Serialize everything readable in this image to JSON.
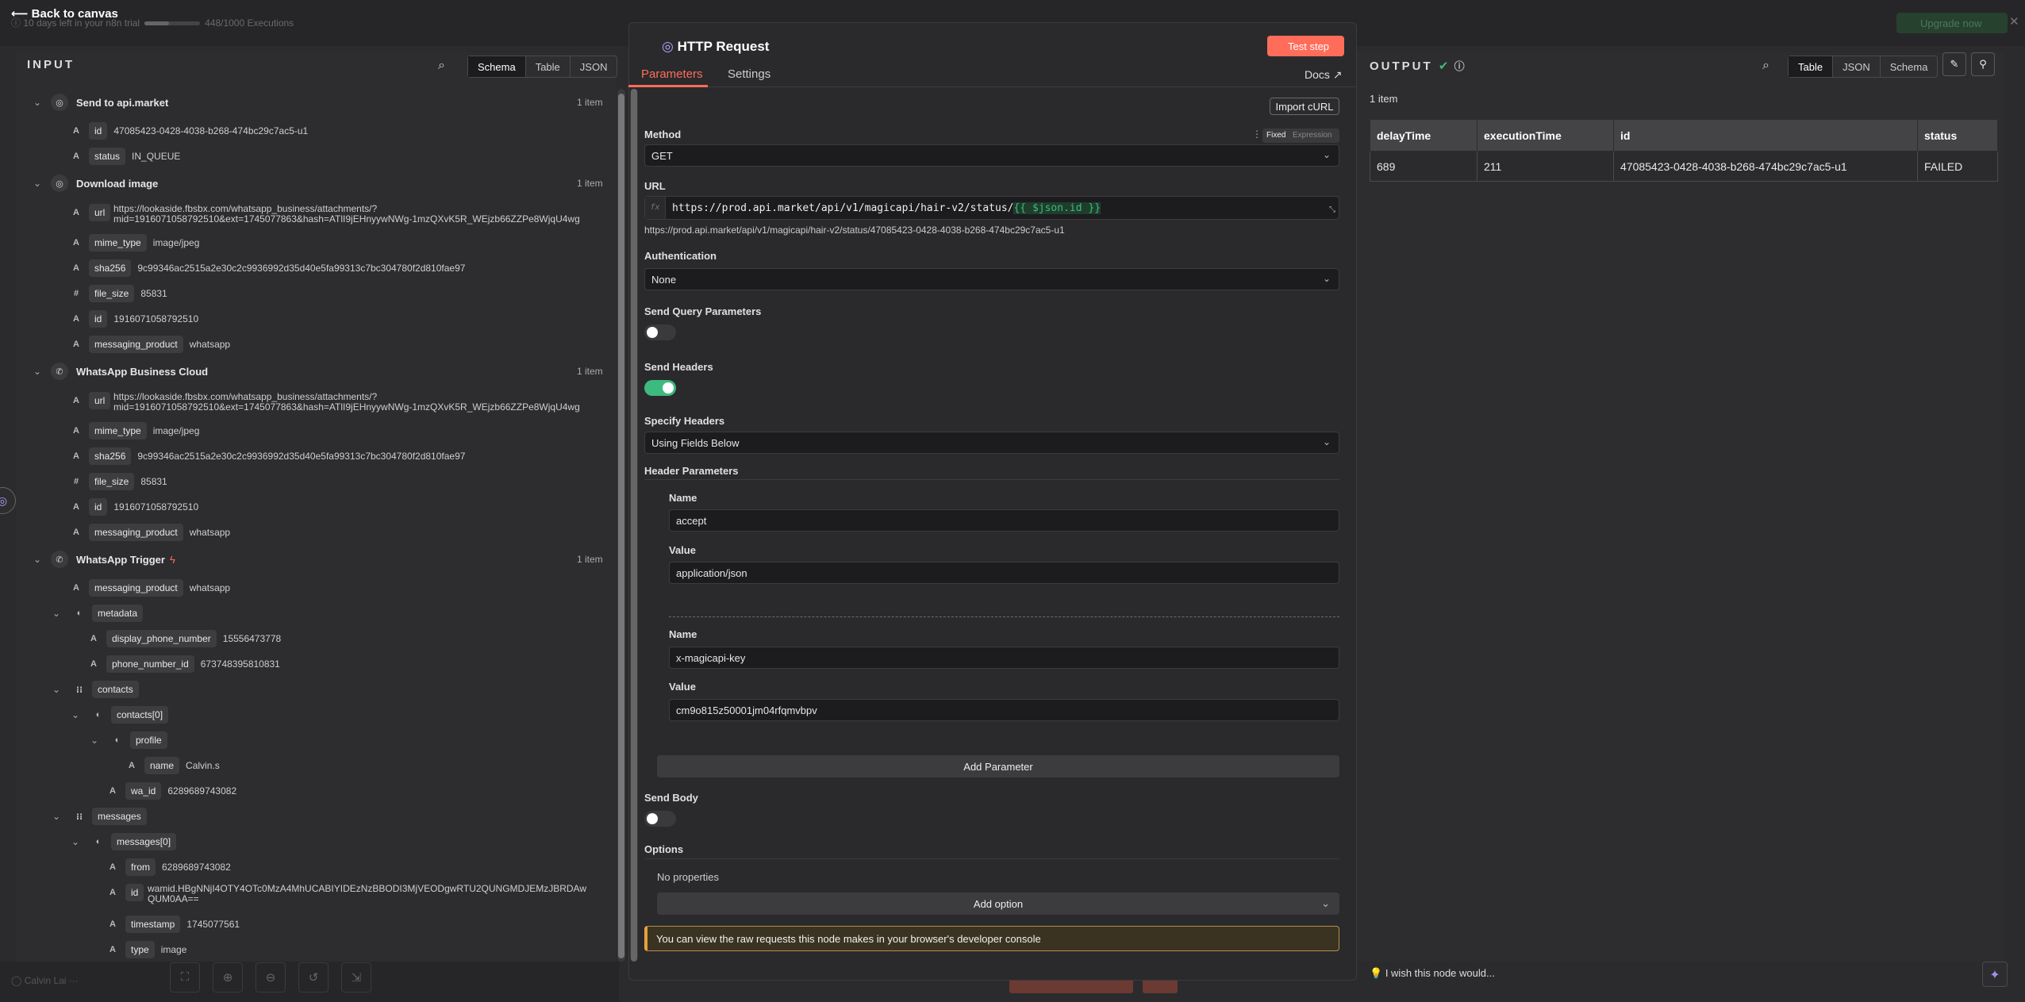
{
  "topbar": {
    "back": "Back to canvas",
    "trial": "10 days left in your n8n trial",
    "executions": "448/1000 Executions",
    "upgrade": "Upgrade now",
    "executions_fill": 0.448
  },
  "input": {
    "title": "INPUT",
    "views": [
      "Schema",
      "Table",
      "JSON"
    ],
    "active_view": "Schema",
    "nodes": [
      {
        "name": "Send to api.market",
        "count": "1 item",
        "fields": [
          [
            "A",
            "id",
            "47085423-0428-4038-b268-474bc29c7ac5-u1"
          ],
          [
            "A",
            "status",
            "IN_QUEUE"
          ]
        ]
      },
      {
        "name": "Download image",
        "count": "1 item",
        "url1": "https://lookaside.fbsbx.com/whatsapp_business/attachments/?",
        "url2": "mid=1916071058792510&ext=1745077863&hash=ATlI9jEHnyywNWg-1mzQXvK5R_WEjzb66ZZPe8WjqU4wg",
        "fields": [
          [
            "A",
            "mime_type",
            "image/jpeg"
          ],
          [
            "A",
            "sha256",
            "9c99346ac2515a2e30c2c9936992d35d40e5fa99313c7bc304780f2d810fae97"
          ],
          [
            "#",
            "file_size",
            "85831"
          ],
          [
            "A",
            "id",
            "1916071058792510"
          ],
          [
            "A",
            "messaging_product",
            "whatsapp"
          ]
        ]
      },
      {
        "name": "WhatsApp Business Cloud",
        "count": "1 item",
        "url1": "https://lookaside.fbsbx.com/whatsapp_business/attachments/?",
        "url2": "mid=1916071058792510&ext=1745077863&hash=ATlI9jEHnyywNWg-1mzQXvK5R_WEjzb66ZZPe8WjqU4wg",
        "fields": [
          [
            "A",
            "mime_type",
            "image/jpeg"
          ],
          [
            "A",
            "sha256",
            "9c99346ac2515a2e30c2c9936992d35d40e5fa99313c7bc304780f2d810fae97"
          ],
          [
            "#",
            "file_size",
            "85831"
          ],
          [
            "A",
            "id",
            "1916071058792510"
          ],
          [
            "A",
            "messaging_product",
            "whatsapp"
          ]
        ]
      },
      {
        "name": "WhatsApp Trigger",
        "count": "1 item"
      }
    ],
    "trigger": {
      "messaging_product": "whatsapp",
      "metadata": "metadata",
      "display_phone_number": "15556473778",
      "phone_number_id": "673748395810831",
      "contacts": "contacts",
      "contacts0": "contacts[0]",
      "profile": "profile",
      "name": "Calvin.s",
      "wa_id": "6289689743082",
      "messages": "messages",
      "messages0": "messages[0]",
      "from": "6289689743082",
      "msg_id1": "wamid.HBgNNjI4OTY4OTc0MzA4MhUCABIYIDEzNzBBODI3MjVEODgwRTU2QUNGMDJEMzJBRDAw",
      "msg_id2": "QUM0AA==",
      "timestamp": "1745077561",
      "type": "image"
    },
    "keys": {
      "id": "id",
      "status": "status",
      "url": "url",
      "mime_type": "mime_type",
      "sha256": "sha256",
      "file_size": "file_size",
      "messaging_product": "messaging_product",
      "display_phone_number": "display_phone_number",
      "phone_number_id": "phone_number_id",
      "name": "name",
      "wa_id": "wa_id",
      "from": "from",
      "timestamp": "timestamp",
      "type": "type"
    },
    "types": {
      "A": "A",
      "N": "#",
      "L": "⁝⁝",
      "O": "◐"
    }
  },
  "modal": {
    "title": "HTTP Request",
    "test_step": "Test step",
    "tabs": [
      "Parameters",
      "Settings"
    ],
    "docs": "Docs",
    "import_curl": "Import cURL",
    "method_label": "Method",
    "method": "GET",
    "fixed": "Fixed",
    "expression": "Expression",
    "url_label": "URL",
    "url_static": "https://prod.api.market/api/v1/magicapi/hair-v2/status/",
    "url_expr": "{{ $json.id }}",
    "url_resolved": "https://prod.api.market/api/v1/magicapi/hair-v2/status/47085423-0428-4038-b268-474bc29c7ac5-u1",
    "auth_label": "Authentication",
    "auth": "None",
    "send_query_label": "Send Query Parameters",
    "send_query": false,
    "send_headers_label": "Send Headers",
    "send_headers": true,
    "specify_headers_label": "Specify Headers",
    "specify_headers": "Using Fields Below",
    "header_params_label": "Header Parameters",
    "headers": [
      {
        "name_label": "Name",
        "name": "accept",
        "value_label": "Value",
        "value": "application/json"
      },
      {
        "name_label": "Name",
        "name": "x-magicapi-key",
        "value_label": "Value",
        "value": "cm9o815z50001jm04rfqmvbpv"
      }
    ],
    "add_parameter": "Add Parameter",
    "send_body_label": "Send Body",
    "send_body": false,
    "options_label": "Options",
    "no_properties": "No properties",
    "add_option": "Add option",
    "note": "You can view the raw requests this node makes in your browser's developer console"
  },
  "output": {
    "title": "OUTPUT",
    "views": [
      "Table",
      "JSON",
      "Schema"
    ],
    "active_view": "Table",
    "count": "1 item",
    "columns": [
      "delayTime",
      "executionTime",
      "id",
      "status"
    ],
    "rows": [
      [
        "689",
        "211",
        "47085423-0428-4038-b268-474bc29c7ac5-u1",
        "FAILED"
      ]
    ],
    "wish": "I wish this node would..."
  },
  "bottom": {
    "user": "Calvin Lai"
  },
  "colors": {
    "accent": "#ff6d5a",
    "success": "#3dba7e",
    "warning": "#e6a23c"
  }
}
